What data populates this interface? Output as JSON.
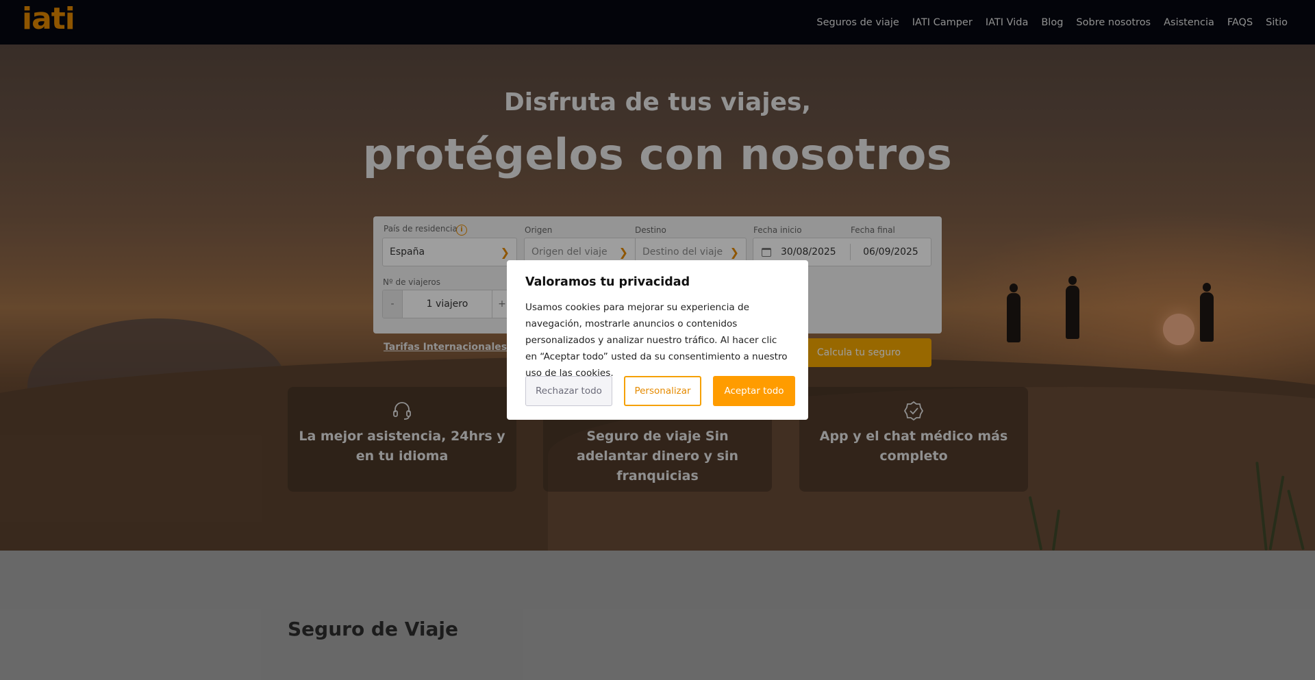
{
  "brand": {
    "logo": "iati"
  },
  "nav": {
    "items": [
      "Seguros de viaje",
      "IATI Camper",
      "IATI Vida",
      "Blog",
      "Sobre nosotros",
      "Asistencia",
      "FAQS",
      " Sitio"
    ]
  },
  "hero": {
    "title_line1": "Disfruta de tus viajes,",
    "title_line2": "protégelos con nosotros"
  },
  "form": {
    "residence_label": "País de residencia",
    "residence_value": "España",
    "origin_label": "Origen",
    "origin_placeholder": "Origen del viaje",
    "destination_label": "Destino",
    "destination_placeholder": "Destino del viaje",
    "start_label": "Fecha inicio",
    "start_value": "30/08/2025",
    "end_label": "Fecha final",
    "end_value": "06/09/2025",
    "travellers_label": "Nº de viajeros",
    "travellers_value": "1 viajero",
    "minus": "-",
    "plus": "+",
    "submit": "Calcula tu seguro",
    "info": "i"
  },
  "tarifas": "Tarifas Internacionales : (",
  "features": [
    {
      "text": "La mejor asistencia, 24hrs y en tu idioma",
      "icon": "headset-icon"
    },
    {
      "text": "Seguro de viaje Sin adelantar dinero y sin franquicias",
      "icon": "wallet-icon"
    },
    {
      "text": "App y el chat médico más completo",
      "icon": "badge-check-icon"
    }
  ],
  "section": {
    "title": "Seguro de Viaje"
  },
  "cookie": {
    "title": "Valoramos tu privacidad",
    "body": "Usamos cookies para mejorar su experiencia de navegación, mostrarle anuncios o contenidos personalizados y analizar nuestro tráfico. Al hacer clic en “Aceptar todo” usted da su consentimiento a nuestro uso de las cookies.",
    "reject": "Rechazar todo",
    "customize": "Personalizar",
    "accept": "Aceptar todo"
  },
  "colors": {
    "accent": "#f5a800",
    "nav_bg": "#050811",
    "brand": "#e58a00"
  }
}
